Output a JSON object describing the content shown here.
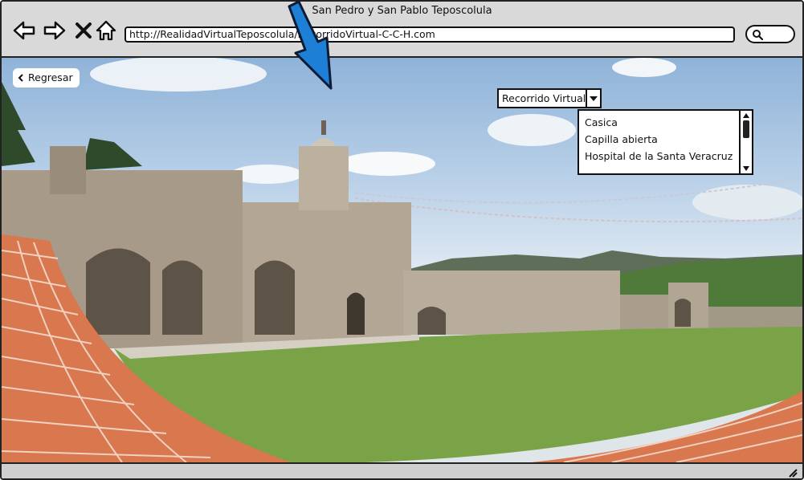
{
  "window": {
    "title": "San Pedro y San Pablo Teposcolula",
    "url": "http://RealidadVirtualTeposcolula/RecorridoVirtual-C-C-H.com"
  },
  "nav": {
    "icons": [
      "arrow-left-icon",
      "arrow-right-icon",
      "close-icon",
      "home-icon"
    ],
    "search_icon": "search-icon"
  },
  "page": {
    "back_label": "Regresar",
    "tour_select": {
      "selected": "Recorrido Virtual",
      "options": [
        "Casica",
        "Capilla abierta",
        "Hospital de la Santa Veracruz"
      ]
    }
  },
  "colors": {
    "annotation_arrow": "#1e7fd6",
    "tile": "#d9774f",
    "grass": "#7aa347"
  }
}
